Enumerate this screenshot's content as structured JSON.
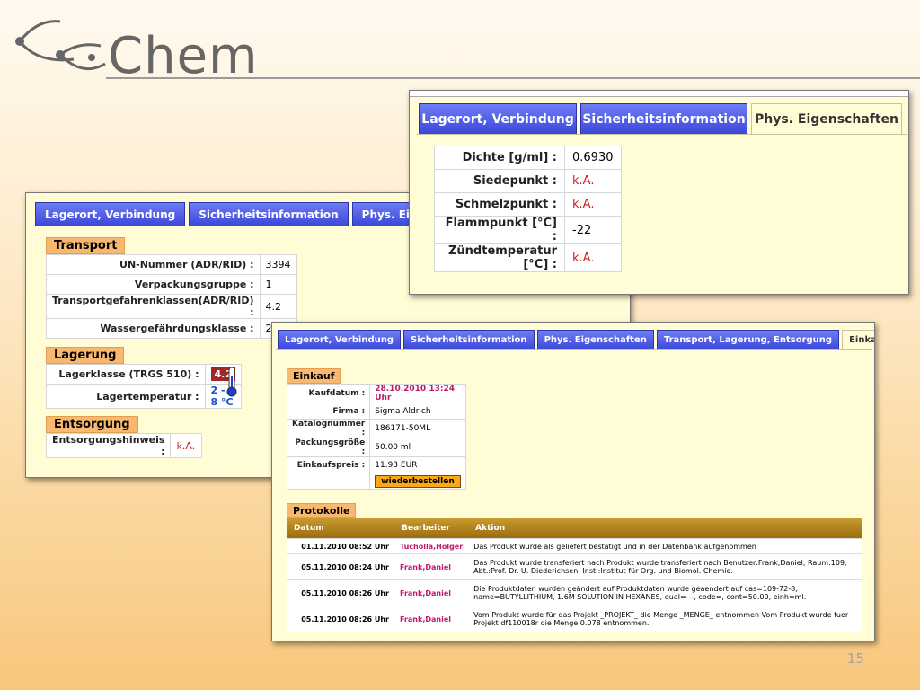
{
  "logo": {
    "text": "Chem"
  },
  "slide_number": "15",
  "win1": {
    "tabs": [
      "Lagerort, Verbindung",
      "Sicherheitsinformation",
      "Phys. Eigenschaften"
    ],
    "transport": {
      "title": "Transport",
      "rows": [
        {
          "label": "UN-Nummer (ADR/RID) :",
          "value": "3394"
        },
        {
          "label": "Verpackungsgruppe :",
          "value": "1"
        },
        {
          "label": "Transportgefahrenklassen(ADR/RID) :",
          "value": "4.2"
        },
        {
          "label": "Wassergefährdungsklasse :",
          "value": "2"
        }
      ]
    },
    "lagerung": {
      "title": "Lagerung",
      "lagerklasse_label": "Lagerklasse (TRGS 510) :",
      "lagerklasse_value": "4.2",
      "lagertemp_label": "Lagertemperatur :",
      "lagertemp_value": "2 - 8 °C"
    },
    "entsorgung": {
      "title": "Entsorgung",
      "label": "Entsorgungshinweis :",
      "value": "k.A."
    }
  },
  "win2": {
    "tabs": [
      "Lagerort, Verbindung",
      "Sicherheitsinformation",
      "Phys. Eigenschaften"
    ],
    "active_tab": 2,
    "rows": [
      {
        "label": "Dichte [g/ml] :",
        "value": "0.6930",
        "unknown": false
      },
      {
        "label": "Siedepunkt :",
        "value": "k.A.",
        "unknown": true
      },
      {
        "label": "Schmelzpunkt :",
        "value": "k.A.",
        "unknown": true
      },
      {
        "label": "Flammpunkt [°C] :",
        "value": "-22",
        "unknown": false
      },
      {
        "label": "Zündtemperatur [°C] :",
        "value": "k.A.",
        "unknown": true
      }
    ]
  },
  "win3": {
    "tabs": [
      "Lagerort, Verbindung",
      "Sicherheitsinformation",
      "Phys. Eigenschaften",
      "Transport, Lagerung, Entsorgung",
      "Einkauf, Protokolle"
    ],
    "active_tab": 4,
    "einkauf": {
      "title": "Einkauf",
      "rows": [
        {
          "label": "Kaufdatum :",
          "value": "28.10.2010 13:24 Uhr"
        },
        {
          "label": "Firma :",
          "value": "Sigma Aldrich"
        },
        {
          "label": "Katalognummer :",
          "value": "186171-50ML"
        },
        {
          "label": "Packungsgröße :",
          "value": "50.00 ml"
        },
        {
          "label": "Einkaufspreis :",
          "value": "11.93 EUR"
        }
      ],
      "button": "wiederbestellen"
    },
    "protokolle": {
      "title": "Protokolle",
      "headers": [
        "Datum",
        "Bearbeiter",
        "Aktion"
      ],
      "rows": [
        {
          "datum": "01.11.2010 08:52 Uhr",
          "bearbeiter": "Tucholla,Holger",
          "aktion": "Das Produkt wurde als geliefert bestätigt und in der Datenbank aufgenommen"
        },
        {
          "datum": "05.11.2010 08:24 Uhr",
          "bearbeiter": "Frank,Daniel",
          "aktion": "Das Produkt wurde transferiert nach Produkt wurde transferiert nach Benutzer:Frank,Daniel, Raum:109, Abt.:Prof. Dr. U. Diederichsen, Inst.:Institut für Org. und Biomol. Chemie."
        },
        {
          "datum": "05.11.2010 08:26 Uhr",
          "bearbeiter": "Frank,Daniel",
          "aktion": "Die Produktdaten wurden geändert auf Produktdaten wurde geaendert auf cas=109-72-8, name=BUTYLLITHIUM, 1.6M SOLUTION IN HEXANES, qual=---, code=, cont=50.00, einh=ml."
        },
        {
          "datum": "05.11.2010 08:26 Uhr",
          "bearbeiter": "Frank,Daniel",
          "aktion": "Vom Produkt wurde für das Projekt _PROJEKT_ die Menge _MENGE_ entnommen Vom Produkt wurde fuer Projekt df110018r die Menge 0.078 entnommen."
        }
      ]
    }
  }
}
